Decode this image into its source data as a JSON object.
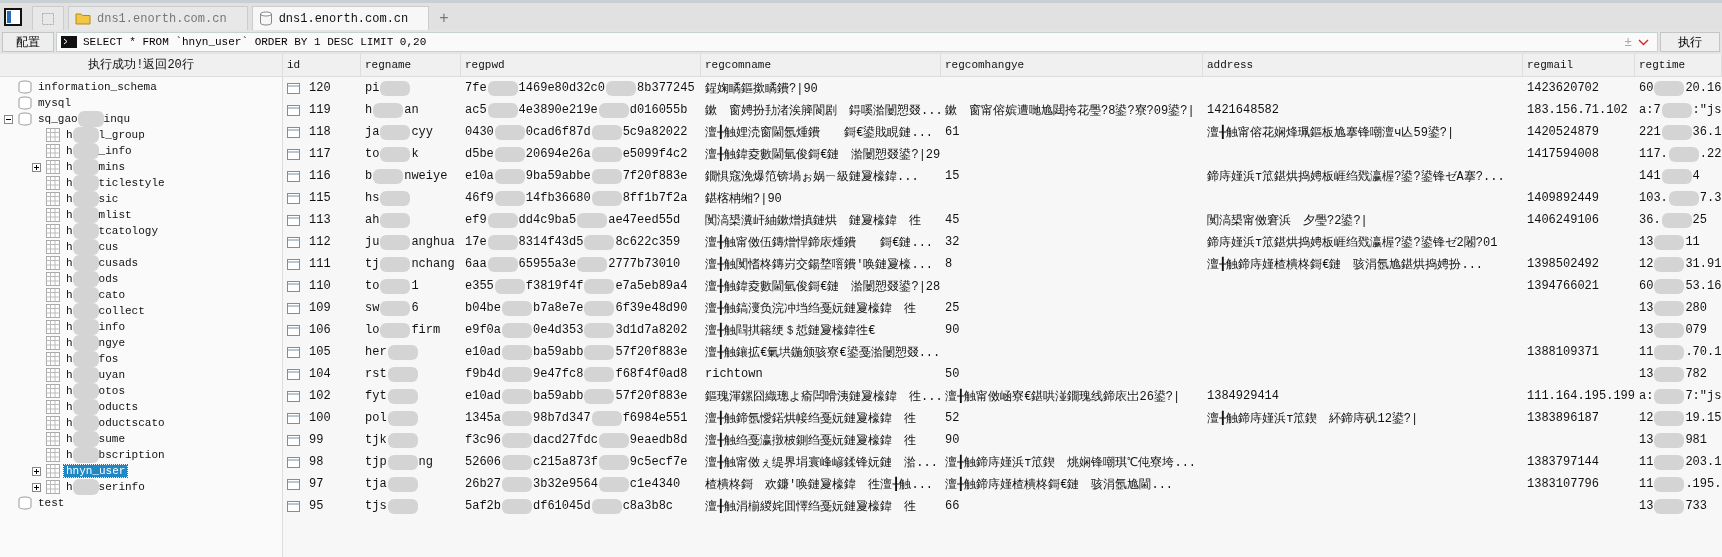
{
  "tabs": [
    {
      "kind": "blank",
      "selected": false
    },
    {
      "kind": "folder",
      "label": "dns1.enorth.com.cn",
      "selected": false
    },
    {
      "kind": "database",
      "label": "dns1.enorth.com.cn",
      "selected": true
    }
  ],
  "new_tab": "+",
  "toolbar": {
    "config_button": "配置",
    "query": "SELECT * FROM `hnyn_user` ORDER BY 1 DESC LIMIT 0,20",
    "plus_minus": "±",
    "execute_button": "执行"
  },
  "status": "执行成功!返回20行",
  "tree": [
    {
      "kind": "database",
      "label": [
        "information_schema"
      ],
      "selected": false
    },
    {
      "kind": "database",
      "label": [
        "mysql"
      ],
      "selected": false
    },
    {
      "kind": "database",
      "label": [
        "sq_gao",
        {
          "kind": "redacted"
        },
        "inqu"
      ],
      "selected": false,
      "expanded": true,
      "children": [
        {
          "kind": "table",
          "label": [
            "h",
            {
              "kind": "redacted"
            },
            "l_group"
          ],
          "selected": false
        },
        {
          "kind": "table",
          "label": [
            "h",
            {
              "kind": "redacted"
            },
            "_info"
          ],
          "selected": false
        },
        {
          "kind": "table",
          "label": [
            "h",
            {
              "kind": "redacted"
            },
            "mins"
          ],
          "selected": false,
          "expanded": false
        },
        {
          "kind": "table",
          "label": [
            "h",
            {
              "kind": "redacted"
            },
            "ticlestyle"
          ],
          "selected": false
        },
        {
          "kind": "table",
          "label": [
            "h",
            {
              "kind": "redacted"
            },
            "sic"
          ],
          "selected": false
        },
        {
          "kind": "table",
          "label": [
            "h",
            {
              "kind": "redacted"
            },
            "mlist"
          ],
          "selected": false
        },
        {
          "kind": "table",
          "label": [
            "h",
            {
              "kind": "redacted"
            },
            "tcatology"
          ],
          "selected": false
        },
        {
          "kind": "table",
          "label": [
            "h",
            {
              "kind": "redacted"
            },
            "cus"
          ],
          "selected": false
        },
        {
          "kind": "table",
          "label": [
            "h",
            {
              "kind": "redacted"
            },
            "cusads"
          ],
          "selected": false
        },
        {
          "kind": "table",
          "label": [
            "h",
            {
              "kind": "redacted"
            },
            "ods"
          ],
          "selected": false
        },
        {
          "kind": "table",
          "label": [
            "h",
            {
              "kind": "redacted"
            },
            "cato"
          ],
          "selected": false
        },
        {
          "kind": "table",
          "label": [
            "h",
            {
              "kind": "redacted"
            },
            "collect"
          ],
          "selected": false
        },
        {
          "kind": "table",
          "label": [
            "h",
            {
              "kind": "redacted"
            },
            "info"
          ],
          "selected": false
        },
        {
          "kind": "table",
          "label": [
            "h",
            {
              "kind": "redacted"
            },
            "ngye"
          ],
          "selected": false
        },
        {
          "kind": "table",
          "label": [
            "h",
            {
              "kind": "redacted"
            },
            "fos"
          ],
          "selected": false
        },
        {
          "kind": "table",
          "label": [
            "h",
            {
              "kind": "redacted"
            },
            "uyan"
          ],
          "selected": false
        },
        {
          "kind": "table",
          "label": [
            "h",
            {
              "kind": "redacted"
            },
            "otos"
          ],
          "selected": false
        },
        {
          "kind": "table",
          "label": [
            "h",
            {
              "kind": "redacted"
            },
            "oducts"
          ],
          "selected": false
        },
        {
          "kind": "table",
          "label": [
            "h",
            {
              "kind": "redacted"
            },
            "oductscato"
          ],
          "selected": false
        },
        {
          "kind": "table",
          "label": [
            "h",
            {
              "kind": "redacted"
            },
            "sume"
          ],
          "selected": false
        },
        {
          "kind": "table",
          "label": [
            "h",
            {
              "kind": "redacted"
            },
            "bscription"
          ],
          "selected": false
        },
        {
          "kind": "table",
          "label": [
            "hnyn_user"
          ],
          "selected": true,
          "expanded": false
        },
        {
          "kind": "table",
          "label": [
            "h",
            {
              "kind": "redacted"
            },
            "serinfo"
          ],
          "selected": false,
          "expanded": false
        }
      ]
    },
    {
      "kind": "database",
      "label": [
        "test"
      ],
      "selected": false
    }
  ],
  "table": {
    "columns": [
      "id",
      "regname",
      "regpwd",
      "regcomname",
      "regcomhangye",
      "address",
      "regmail",
      "regtime"
    ],
    "rows": [
      {
        "cells": [
          [
            "120"
          ],
          [
            "pi",
            {
              "kind": "redacted"
            }
          ],
          [
            "7fe",
            {
              "kind": "redacted"
            },
            "1469e80d32c0",
            {
              "kind": "redacted"
            },
            "8b377245"
          ],
          [
            "鍟婅瞲鏂撳瞲鐨?|90"
          ],
          [],
          [],
          [
            "1423620702"
          ],
          [
            "60",
            {
              "kind": "redacted"
            },
            "20.16"
          ]
        ]
      },
      {
        "cells": [
          [
            "119"
          ],
          [
            "h",
            {
              "kind": "redacted"
            },
            "an"
          ],
          [
            "ac5",
            {
              "kind": "redacted"
            },
            "4e3890e219e",
            {
              "kind": "redacted"
            },
            "d016055b"
          ],
          [
            "鏉　窗娉扮劧渚涘簲閬剧　鍀嗘湁闄愬叕..."
          ],
          [
            "鏉　窗甯傛嫔遭哋尯閮挎花璺?8鍙?寮?09鍙?|"
          ],
          [
            "1421648582"
          ],
          [
            "183.156.71.102"
          ],
          [
            "a:7",
            {
              "kind": "redacted"
            },
            ":\"js"
          ]
        ]
      },
      {
        "cells": [
          [
            "118"
          ],
          [
            "ja",
            {
              "kind": "redacted"
            },
            "cyy"
          ],
          [
            "0430",
            {
              "kind": "redacted"
            },
            "0cad6f87d",
            {
              "kind": "redacted"
            },
            "5c9a82022"
          ],
          [
            "澶╂触娌涜窗閫氬煄鐨　　鎶€鍙戝睍鏈..."
          ],
          [
            "61"
          ],
          [
            "澶╂触甯傛花娴烽珮鏂板尯搴锋嘲澶ч亾59鍙?|"
          ],
          [
            "1420524879"
          ],
          [
            "221",
            {
              "kind": "redacted"
            },
            "36.1"
          ]
        ]
      },
      {
        "cells": [
          [
            "117"
          ],
          [
            "to",
            {
              "kind": "redacted"
            },
            "k"
          ],
          [
            "d5be",
            {
              "kind": "redacted"
            },
            "20694e26a",
            {
              "kind": "redacted"
            },
            "e5099f4c2"
          ],
          [
            "澶╂触鍏夌數閫氫俊鎶€鏈　湁闄愬叕鍙?|29"
          ],
          [],
          [],
          [
            "1417594008"
          ],
          [
            "117.",
            {
              "kind": "redacted"
            },
            ".22"
          ]
        ]
      },
      {
        "cells": [
          [
            "116"
          ],
          [
            "b",
            {
              "kind": "redacted"
            },
            "nweiye"
          ],
          [
            "e10a",
            {
              "kind": "redacted"
            },
            "9ba59abbe",
            {
              "kind": "redacted"
            },
            "7f20f883e"
          ],
          [
            "鐗惧窛浼爆笵锛堝ぉ娲ㄧ級鏈夐檺鍏..."
          ],
          [
            "15"
          ],
          [
            "鍗庤嫤浜т笟鍖烘捣娉板崕绉戣瀛楃?鍙?鍙锋ゼA搴?..."
          ],
          [],
          [
            "141",
            {
              "kind": "redacted"
            },
            "4"
          ]
        ]
      },
      {
        "cells": [
          [
            "115"
          ],
          [
            "hs",
            {
              "kind": "redacted"
            }
          ],
          [
            "46f9",
            {
              "kind": "redacted"
            },
            "14fb36680",
            {
              "kind": "redacted"
            },
            "8ff1b7f2a"
          ],
          [
            "鍖楁柟缃?|90"
          ],
          [],
          [],
          [
            "1409892449"
          ],
          [
            "103.",
            {
              "kind": "redacted"
            },
            "7.3"
          ]
        ]
      },
      {
        "cells": [
          [
            "113"
          ],
          [
            "ah",
            {
              "kind": "redacted"
            }
          ],
          [
            "ef9",
            {
              "kind": "redacted"
            },
            "dd4c9ba5",
            {
              "kind": "redacted"
            },
            "ae47eed55d"
          ],
          [
            "闃滈槼瀵屽紬鏉熷搷鏈烘　鏈夐檺鍏　徃"
          ],
          [
            "45"
          ],
          [
            "闃滈槼甯傚窘浜　夕璺?2鍙?|"
          ],
          [
            "1406249106"
          ],
          [
            "36.",
            {
              "kind": "redacted"
            },
            "25"
          ]
        ]
      },
      {
        "cells": [
          [
            "112"
          ],
          [
            "ju",
            {
              "kind": "redacted"
            },
            "anghua"
          ],
          [
            "17e",
            {
              "kind": "redacted"
            },
            "8314f43d5",
            {
              "kind": "redacted"
            },
            "8c622c359"
          ],
          [
            "澶╂触甯傚伍鏄熷悍鍗庡煄鐨　　鎶€鏈..."
          ],
          [
            "32"
          ],
          [
            "鍗庤嫤浜т笟鍖烘捣娉板崕绉戣瀛楃?鍙?鍙锋ゼ2闂?01"
          ],
          [],
          [
            "13",
            {
              "kind": "redacted"
            },
            "11"
          ]
        ]
      },
      {
        "cells": [
          [
            "111"
          ],
          [
            "tj",
            {
              "kind": "redacted"
            },
            "nchang"
          ],
          [
            "6aa",
            {
              "kind": "redacted"
            },
            "65955a3e",
            {
              "kind": "redacted"
            },
            "2777b73010"
          ],
          [
            "澶╂触闃愭柊鏄岃交鍚堥噾鐨′唤鏈夐檺..."
          ],
          [
            "8"
          ],
          [
            "澶╂触鍗庤嫤楂樻柊鎶€鏈　骇涓氬尯鍖烘捣娉扮..."
          ],
          [
            "1398502492"
          ],
          [
            "12",
            {
              "kind": "redacted"
            },
            "31.91"
          ]
        ]
      },
      {
        "cells": [
          [
            "110"
          ],
          [
            "to",
            {
              "kind": "redacted"
            },
            "1"
          ],
          [
            "e355",
            {
              "kind": "redacted"
            },
            "f3819f4f",
            {
              "kind": "redacted"
            },
            "e7a5eb89a4"
          ],
          [
            "澶╂触鍏夌數閫氫俊鎶€鏈　湁闄愬叕鍙?|28"
          ],
          [],
          [],
          [
            "1394766021"
          ],
          [
            "60",
            {
              "kind": "redacted"
            },
            "53.16"
          ]
        ]
      },
      {
        "cells": [
          [
            "109"
          ],
          [
            "sw",
            {
              "kind": "redacted"
            },
            "6"
          ],
          [
            "b04be",
            {
              "kind": "redacted"
            },
            "b7a8e7e",
            {
              "kind": "redacted"
            },
            "6f39e48d90"
          ],
          [
            "澶╂触鎬濅负浣冲垱绉戞妧鏈夐檺鍏　徃"
          ],
          [
            "25"
          ],
          [],
          [],
          [
            "13",
            {
              "kind": "redacted"
            },
            "280"
          ]
        ]
      },
      {
        "cells": [
          [
            "106"
          ],
          [
            "lo",
            {
              "kind": "redacted"
            },
            "firm"
          ],
          [
            "e9f0a",
            {
              "kind": "redacted"
            },
            "0e4d353",
            {
              "kind": "redacted"
            },
            "3d1d7a8202"
          ],
          [
            "澶╂触閰掑簵绠＄悊鏈夐檺鍏徃€"
          ],
          [
            "90"
          ],
          [],
          [],
          [
            "13",
            {
              "kind": "redacted"
            },
            "079"
          ]
        ]
      },
      {
        "cells": [
          [
            "105"
          ],
          [
            "her",
            {
              "kind": "redacted"
            }
          ],
          [
            "e10ad",
            {
              "kind": "redacted"
            },
            "ba59abb",
            {
              "kind": "redacted"
            },
            "57f20f883e"
          ],
          [
            "澶╂触鑲拡€氭垬鍦颁骇寮€鍙戞湁闄愬叕..."
          ],
          [],
          [],
          [
            "1388109371"
          ],
          [
            "11",
            {
              "kind": "redacted"
            },
            ".70.1"
          ]
        ]
      },
      {
        "cells": [
          [
            "104"
          ],
          [
            "rst",
            {
              "kind": "redacted"
            }
          ],
          [
            "f9b4d",
            {
              "kind": "redacted"
            },
            "9e47fc8",
            {
              "kind": "redacted"
            },
            "f68f4f0ad8"
          ],
          [
            "richtown"
          ],
          [
            "50"
          ],
          [],
          [],
          [
            "13",
            {
              "kind": "redacted"
            },
            "782"
          ]
        ]
      },
      {
        "cells": [
          [
            "102"
          ],
          [
            "fyt",
            {
              "kind": "redacted"
            }
          ],
          [
            "e10ad",
            {
              "kind": "redacted"
            },
            "ba59abb",
            {
              "kind": "redacted"
            },
            "57f20f883e"
          ],
          [
            "鏂瑰渾鏍囧織璁よ瘉闆嗗洟鏈夐檺鍏　徃..."
          ],
          [
            "澶╂触甯傚崡寮€鍖哄湴鐗瑰线鍗庡岀26鍙?|"
          ],
          [
            "1384929414"
          ],
          [
            "111.164.195.199"
          ],
          [
            "a:",
            {
              "kind": "redacted"
            },
            "7:\"js"
          ]
        ]
      },
      {
        "cells": [
          [
            "100"
          ],
          [
            "pol",
            {
              "kind": "redacted"
            }
          ],
          [
            "1345a",
            {
              "kind": "redacted"
            },
            "98b7d347",
            {
              "kind": "redacted"
            },
            "f6984e551"
          ],
          [
            "澶╂触鍗氬懓鍩烘帹绉戞妧鏈夐檺鍏　徃"
          ],
          [
            "52"
          ],
          [
            "澶╂触鍗庤嫤浜т笟鍥　紑鍗庤矾12鍙?|"
          ],
          [
            "1383896187"
          ],
          [
            "12",
            {
              "kind": "redacted"
            },
            "19.15"
          ]
        ]
      },
      {
        "cells": [
          [
            "99"
          ],
          [
            "tjk",
            {
              "kind": "redacted"
            }
          ],
          [
            "f3c96",
            {
              "kind": "redacted"
            },
            "dacd27fdc",
            {
              "kind": "redacted"
            },
            "9eaedb8d"
          ],
          [
            "澶╂触绉戞瀛撴柀鍘绉戞妧鏈夐檺鍏　徃"
          ],
          [
            "90"
          ],
          [],
          [],
          [
            "13",
            {
              "kind": "redacted"
            },
            "981"
          ]
        ]
      },
      {
        "cells": [
          [
            "98"
          ],
          [
            "tjp",
            {
              "kind": "redacted"
            },
            "ng"
          ],
          [
            "52606",
            {
              "kind": "redacted"
            },
            "c215a873f",
            {
              "kind": "redacted"
            },
            "9c5ecf7e"
          ],
          [
            "澶╂触甯傚ぇ缇界埍寰峰嵃鍒锋妧鏈　湁..."
          ],
          [
            "澶╂触鍗庤嫤浜т笟鍥　烑娴锋嘲琪℃伅寮垮..."
          ],
          [],
          [
            "1383797144"
          ],
          [
            "11",
            {
              "kind": "redacted"
            },
            "203.1"
          ]
        ]
      },
      {
        "cells": [
          [
            "97"
          ],
          [
            "tja",
            {
              "kind": "redacted"
            }
          ],
          [
            "26b27",
            {
              "kind": "redacted"
            },
            "3b32e9564",
            {
              "kind": "redacted"
            },
            "c1e4340"
          ],
          [
            "楂樻柊鎶　欢鐮′唤鏈夐檺鍏　徃澶╂触..."
          ],
          [
            "澶╂触鍗庤嫤楂樻柊鎶€鏈　骇涓氬尯閫..."
          ],
          [],
          [
            "1383107796"
          ],
          [
            "11",
            {
              "kind": "redacted"
            },
            ".195."
          ]
        ]
      },
      {
        "cells": [
          [
            "95"
          ],
          [
            "tjs",
            {
              "kind": "redacted"
            }
          ],
          [
            "5af2b",
            {
              "kind": "redacted"
            },
            "df61045d",
            {
              "kind": "redacted"
            },
            "c8a3b8c"
          ],
          [
            "澶╂触涓椾緵姹囬懌绉戞妧鏈夐檺鍏　徃"
          ],
          [
            "66"
          ],
          [],
          [],
          [
            "13",
            {
              "kind": "redacted"
            },
            "733"
          ]
        ]
      }
    ]
  }
}
